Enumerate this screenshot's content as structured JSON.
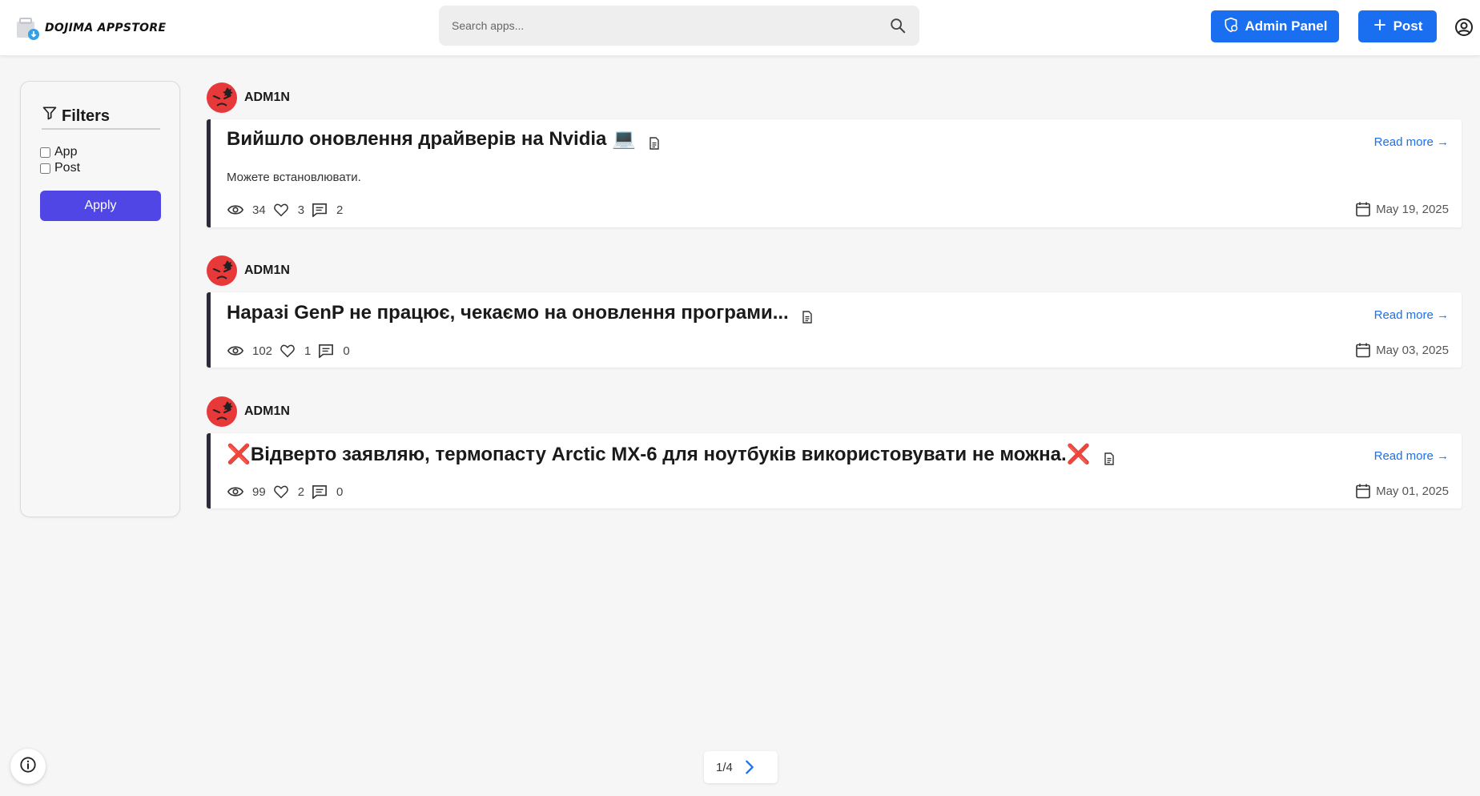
{
  "app": {
    "name": "DOJIMA APPSTORE"
  },
  "search": {
    "placeholder": "Search apps..."
  },
  "header": {
    "admin_label": "Admin Panel",
    "post_label": "Post"
  },
  "filters": {
    "title": "Filters",
    "options": [
      {
        "label": "App",
        "checked": false
      },
      {
        "label": "Post",
        "checked": false
      }
    ],
    "apply_label": "Apply"
  },
  "posts": [
    {
      "author": "ADM1N",
      "title": "Вийшло оновлення драйверів на Nvidia 💻",
      "excerpt": "Можете встановлювати.",
      "views": "34",
      "likes": "3",
      "comments": "2",
      "date": "May 19, 2025",
      "read_more": "Read more →"
    },
    {
      "author": "ADM1N",
      "title": "Наразі GenP не працює, чекаємо на оновлення програми...",
      "excerpt": "",
      "views": "102",
      "likes": "1",
      "comments": "0",
      "date": "May 03, 2025",
      "read_more": "Read more →"
    },
    {
      "author": "ADM1N",
      "title": "❌Відверто заявляю, термопасту Arctic MX-6 для ноутбуків використовувати не можна.❌",
      "excerpt": "",
      "views": "99",
      "likes": "2",
      "comments": "0",
      "date": "May 01, 2025",
      "read_more": "Read more →"
    }
  ],
  "pagination": {
    "label": "1/4"
  },
  "colors": {
    "accent": "#1a6ef0",
    "apply": "#4f46e5",
    "card_border": "#2b2b3a",
    "avatar": "#e8393a"
  }
}
